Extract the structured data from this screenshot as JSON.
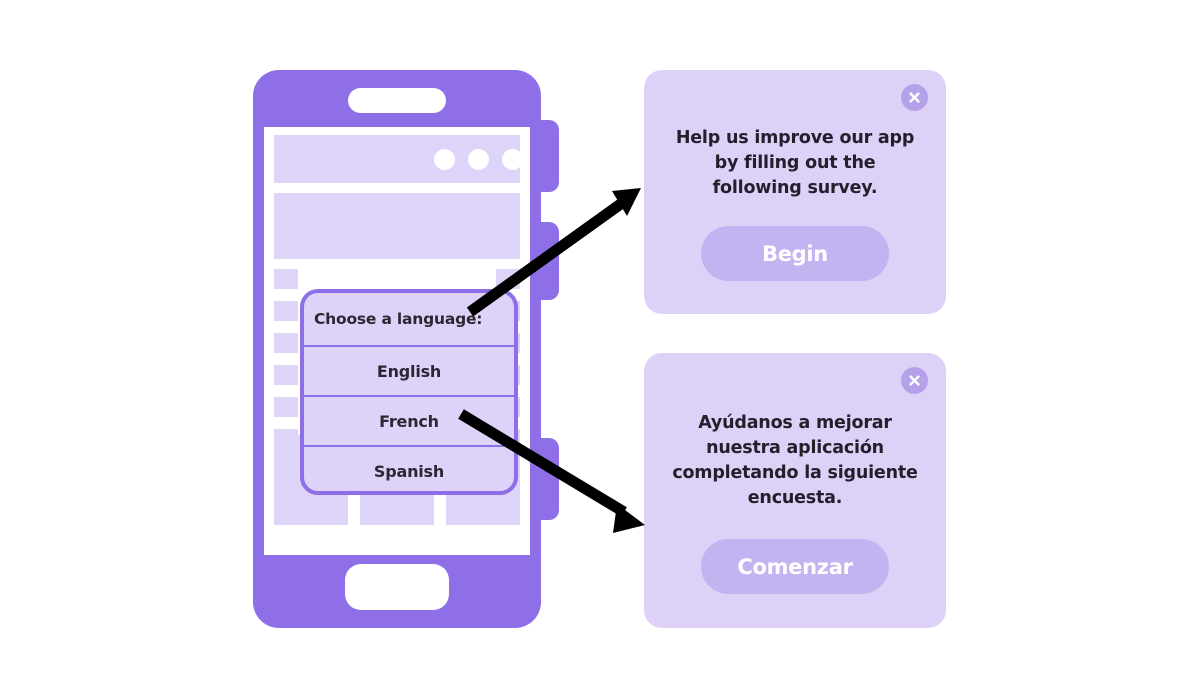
{
  "colors": {
    "page_background": "#ffffff",
    "phone_body": "#8f6fe8",
    "screen_placeholder": "#ded3f8",
    "dialog_background": "#ddd1f7",
    "cta_button": "#c3b3f0",
    "close_button": "#b5a1ea",
    "text_dark": "#231f2b",
    "arrow": "#000000"
  },
  "phone": {
    "name": "smartphone-mockup",
    "notch": "speaker-notch",
    "home_indicator": "home-button",
    "side_buttons": [
      "volume-up",
      "volume-down",
      "power"
    ],
    "screen": {
      "topbar_dots": [
        "dot-1",
        "dot-2",
        "dot-3"
      ],
      "language_selector": {
        "title": "Choose a language:",
        "options": [
          {
            "label": "English"
          },
          {
            "label": "French"
          },
          {
            "label": "Spanish"
          }
        ]
      },
      "bottom_columns": [
        "column-1",
        "column-2",
        "column-3"
      ]
    }
  },
  "dialogs": [
    {
      "id": "english",
      "close_icon": "close-icon",
      "message": "Help us improve our app by filling out the following survey.",
      "cta_label": "Begin"
    },
    {
      "id": "spanish",
      "close_icon": "close-icon",
      "message": "Ayúdanos a mejorar nuestra aplicación completando la siguiente encuesta.",
      "cta_label": "Comenzar"
    }
  ],
  "arrows": [
    {
      "id": "arrow-english",
      "from": "english-option",
      "to": "english-dialog",
      "direction": "up-right"
    },
    {
      "id": "arrow-spanish",
      "from": "spanish-option",
      "to": "spanish-dialog",
      "direction": "down-right"
    }
  ]
}
